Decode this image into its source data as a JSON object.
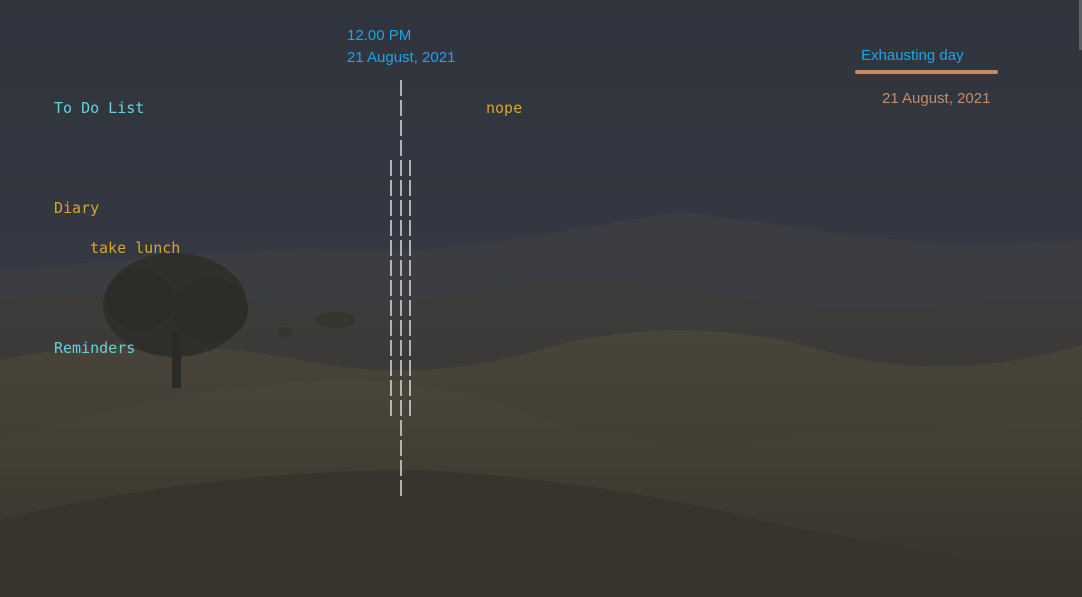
{
  "clock": {
    "time": "12.00 PM",
    "date": "21 August, 2021"
  },
  "sections": {
    "todo_title": "To Do List",
    "todo_item": "nope",
    "diary_title": "Diary",
    "diary_item": "take lunch",
    "reminders_title": "Reminders"
  },
  "mood": {
    "label": "Exhausting day",
    "date": "21 August, 2021"
  },
  "colors": {
    "background": "#2f333c",
    "cyan": "#66d0dc",
    "gold": "#d9a62a",
    "blue": "#1fa3e8",
    "orange": "#c98b63",
    "divider": "#e8e8e8"
  }
}
